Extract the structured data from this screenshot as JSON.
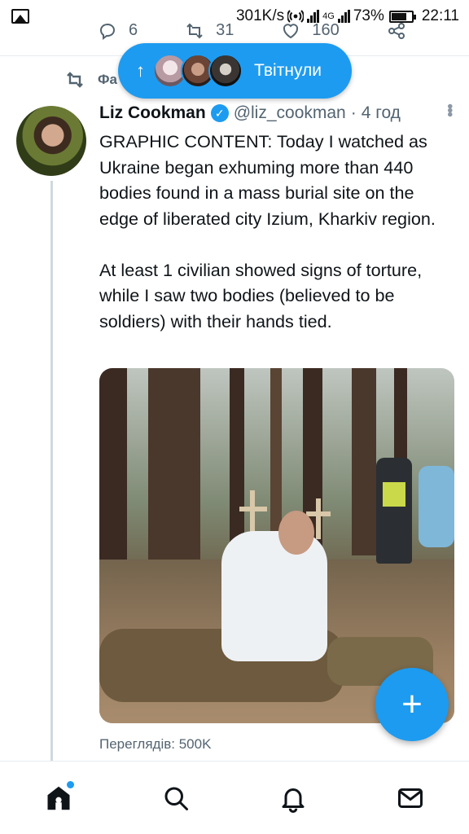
{
  "status_bar": {
    "speed": "301K/s",
    "network": "4G",
    "battery": "73%",
    "time": "22:11"
  },
  "prev_tweet": {
    "reply_count": "6",
    "retweet_count": "31",
    "like_count": "160"
  },
  "retweet_context": {
    "label": "Фа"
  },
  "new_tweets_pill": {
    "label": "Твітнули"
  },
  "tweet": {
    "name": "Liz Cookman",
    "handle": "@liz_cookman",
    "separator": "·",
    "time": "4 год",
    "paragraphs": [
      "GRAPHIC CONTENT: Today I watched as Ukraine began exhuming more than 440 bodies found in a mass burial site on the edge of liberated city Izium, Kharkiv region.",
      "At least 1 civilian showed signs of torture, while I saw two bodies (believed to be soldiers) with their hands tied."
    ],
    "views": "Переглядів: 500K"
  },
  "fab": {
    "icon": "+"
  },
  "colors": {
    "accent": "#1d9bf0",
    "secondary_text": "#536471",
    "primary_text": "#0f1419"
  },
  "icons": [
    "gallery-icon",
    "hotspot-icon",
    "signal-icon",
    "battery-icon",
    "reply-icon",
    "retweet-icon",
    "like-icon",
    "share-icon",
    "verified-icon",
    "more-icon",
    "home-icon",
    "search-icon",
    "bell-icon",
    "mail-icon",
    "compose-icon"
  ]
}
